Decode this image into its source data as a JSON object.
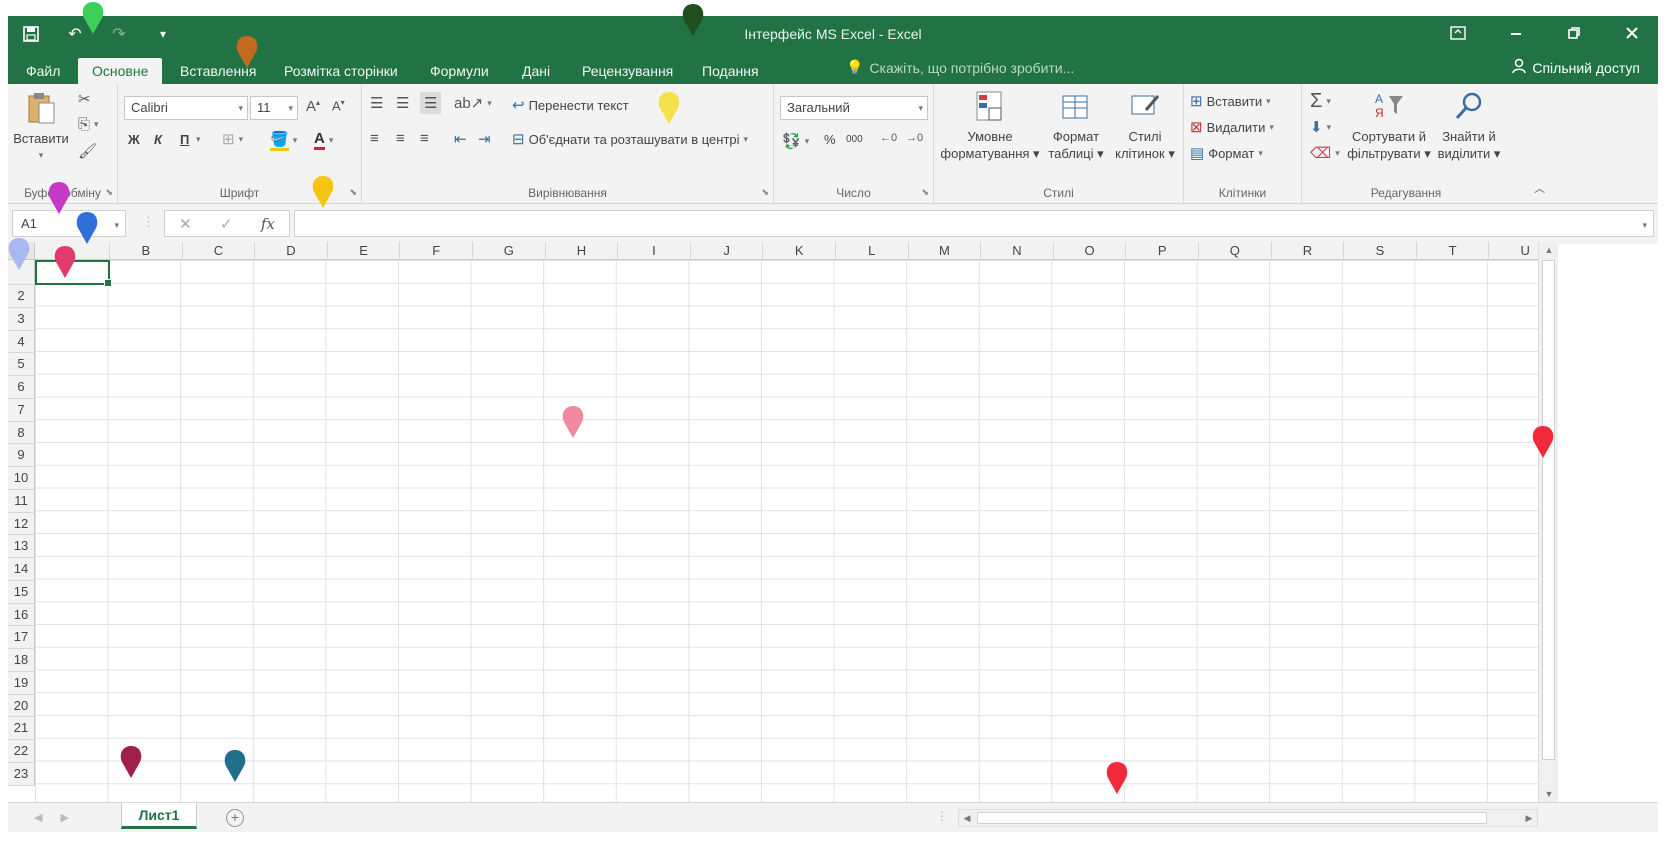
{
  "window": {
    "title": "Інтерфейс MS Excel - Excel",
    "restore_icon": "⧉"
  },
  "qat": {
    "save_icon": "💾",
    "undo_icon": "↶",
    "redo_icon": "↷",
    "customize_icon": "▾"
  },
  "tabs": [
    {
      "label": "Файл"
    },
    {
      "label": "Основне"
    },
    {
      "label": "Вставлення"
    },
    {
      "label": "Розмітка сторінки"
    },
    {
      "label": "Формули"
    },
    {
      "label": "Дані"
    },
    {
      "label": "Рецензування"
    },
    {
      "label": "Подання"
    }
  ],
  "tell_me": "Скажіть, що потрібно зробити...",
  "share": "Спільний доступ",
  "ribbon": {
    "clipboard": {
      "paste": "Вставити",
      "label": "Буфер обміну"
    },
    "font": {
      "name": "Calibri",
      "size": "11",
      "bold": "Ж",
      "italic": "К",
      "underline": "П",
      "label": "Шрифт"
    },
    "alignment": {
      "wrap": "Перенести текст",
      "merge": "Об'єднати та розташувати в центрі",
      "label": "Вирівнювання"
    },
    "number": {
      "format": "Загальний",
      "percent": "%",
      "thousands": "000",
      "label": "Число"
    },
    "styles": {
      "conditional_l1": "Умовне",
      "conditional_l2": "форматування",
      "table_l1": "Формат",
      "table_l2": "таблиці",
      "cell_l1": "Стилі",
      "cell_l2": "клітинок",
      "label": "Стилі"
    },
    "cells": {
      "insert": "Вставити",
      "delete": "Видалити",
      "format": "Формат",
      "label": "Клітинки"
    },
    "editing": {
      "sort_l1": "Сортувати й",
      "sort_l2": "фільтрувати",
      "find_l1": "Знайти й",
      "find_l2": "виділити",
      "label": "Редагування"
    }
  },
  "formula_bar": {
    "name_box": "A1",
    "fx": "fx",
    "value": ""
  },
  "columns": [
    "B",
    "C",
    "D",
    "E",
    "F",
    "G",
    "H",
    "I",
    "J",
    "K",
    "L",
    "M",
    "N",
    "O",
    "P",
    "Q",
    "R",
    "S",
    "T",
    "U"
  ],
  "rows": [
    "2",
    "3",
    "4",
    "5",
    "6",
    "7",
    "8",
    "9",
    "10",
    "11",
    "12",
    "13",
    "14",
    "15",
    "16",
    "17",
    "18",
    "19",
    "20",
    "21",
    "22",
    "23"
  ],
  "sheet_tab": "Лист1",
  "colors": {
    "accent": "#217346",
    "ribbon_bg": "#f3f3f3"
  }
}
